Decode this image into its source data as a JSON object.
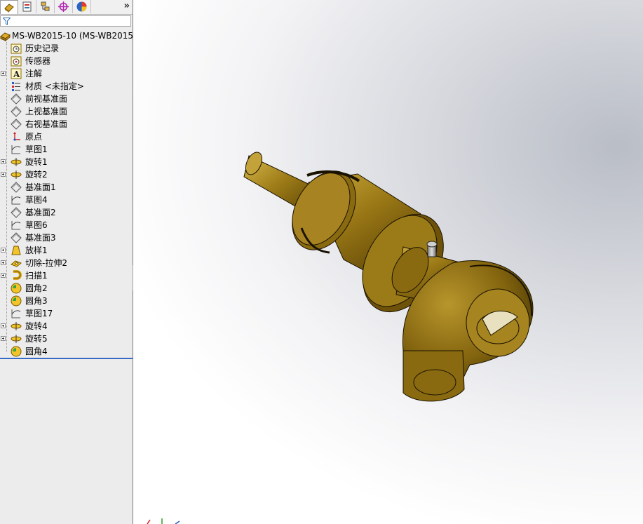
{
  "panel_tabs": [
    {
      "name": "featuremanager-tab-icon",
      "active": true
    },
    {
      "name": "propertymanager-tab-icon",
      "active": false
    },
    {
      "name": "configurationmanager-tab-icon",
      "active": false
    },
    {
      "name": "dimxpert-tab-icon",
      "active": false
    },
    {
      "name": "display-manager-tab-icon",
      "active": false
    }
  ],
  "expand_glyph": "»",
  "tree": {
    "root_label": "MS-WB2015-10  (MS-WB2015",
    "items": [
      {
        "label": "历史记录",
        "icon": "history-icon",
        "expandable": false
      },
      {
        "label": "传感器",
        "icon": "sensor-icon",
        "expandable": false
      },
      {
        "label": "注解",
        "icon": "annotation-icon",
        "expandable": true
      },
      {
        "label": "材质 <未指定>",
        "icon": "material-icon",
        "expandable": false
      },
      {
        "label": "前视基准面",
        "icon": "plane-icon",
        "expandable": false
      },
      {
        "label": "上视基准面",
        "icon": "plane-icon",
        "expandable": false
      },
      {
        "label": "右视基准面",
        "icon": "plane-icon",
        "expandable": false
      },
      {
        "label": "原点",
        "icon": "origin-icon",
        "expandable": false
      },
      {
        "label": "草图1",
        "icon": "sketch-icon",
        "expandable": false
      },
      {
        "label": "旋转1",
        "icon": "revolve-icon",
        "expandable": true
      },
      {
        "label": "旋转2",
        "icon": "revolve-icon",
        "expandable": true
      },
      {
        "label": "基准面1",
        "icon": "plane-icon",
        "expandable": false
      },
      {
        "label": "草图4",
        "icon": "sketch-icon",
        "expandable": false
      },
      {
        "label": "基准面2",
        "icon": "plane-icon",
        "expandable": false
      },
      {
        "label": "草图6",
        "icon": "sketch-icon",
        "expandable": false
      },
      {
        "label": "基准面3",
        "icon": "plane-icon",
        "expandable": false
      },
      {
        "label": "放样1",
        "icon": "loft-icon",
        "expandable": true
      },
      {
        "label": "切除-拉伸2",
        "icon": "cut-extrude-icon",
        "expandable": true
      },
      {
        "label": "扫描1",
        "icon": "sweep-icon",
        "expandable": true
      },
      {
        "label": "圆角2",
        "icon": "fillet-icon",
        "expandable": false
      },
      {
        "label": "圆角3",
        "icon": "fillet-icon",
        "expandable": false
      },
      {
        "label": "草图17",
        "icon": "sketch-icon",
        "expandable": false
      },
      {
        "label": "旋转4",
        "icon": "revolve-icon",
        "expandable": true
      },
      {
        "label": "旋转5",
        "icon": "revolve-icon",
        "expandable": true
      },
      {
        "label": "圆角4",
        "icon": "fillet-icon",
        "expandable": false
      }
    ]
  },
  "colors": {
    "part_body": "#8a6d14",
    "part_highlight": "#c9a83a",
    "part_shadow": "#4d3b05",
    "rollback_bar": "#3a6bc4"
  }
}
